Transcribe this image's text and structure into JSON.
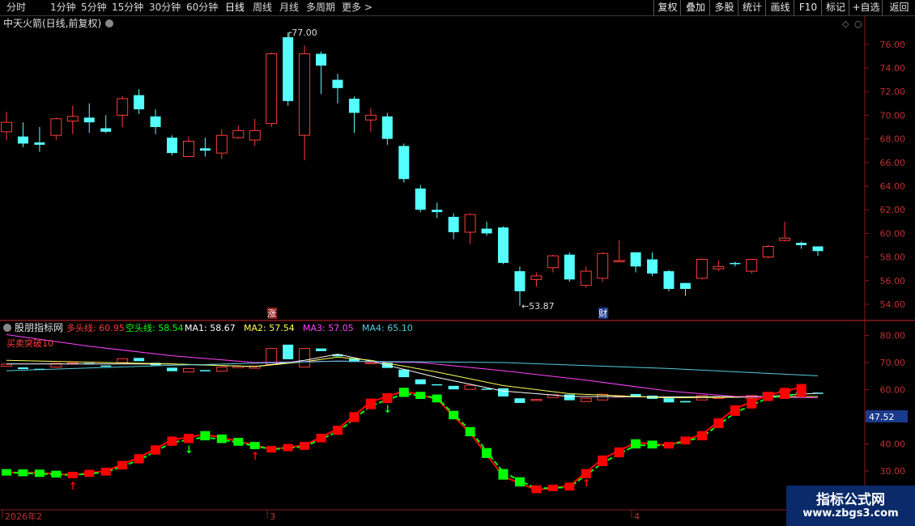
{
  "toolbar": {
    "periods": [
      "分时",
      "1分钟",
      "5分钟",
      "15分钟",
      "30分钟",
      "60分钟",
      "日线",
      "周线",
      "月线",
      "多周期",
      "更多 >"
    ],
    "active_period": "日线",
    "right_buttons": [
      "复权",
      "叠加",
      "多股",
      "统计",
      "画线",
      "F10",
      "标记",
      "+自选",
      "返回"
    ]
  },
  "main_panel": {
    "title": "中天火箭(日线,前复权)",
    "high_marker": "77.00",
    "low_marker": "53.87",
    "event_labels": [
      "涨",
      "财"
    ],
    "price_axis": [
      "76.00",
      "74.00",
      "72.00",
      "70.00",
      "68.00",
      "66.00",
      "64.00",
      "62.00",
      "60.00",
      "58.00",
      "56.00",
      "54.00"
    ]
  },
  "indicator_panel": {
    "name": "股朋指标网",
    "items": [
      {
        "label": "多头线:",
        "value": "60.95",
        "color": "#ff3b3b"
      },
      {
        "label": "空头线:",
        "value": "58.54",
        "color": "#00ff00"
      },
      {
        "label": "MA1:",
        "value": "58.67",
        "color": "#ffffff"
      },
      {
        "label": "MA2:",
        "value": "57.54",
        "color": "#ffff55"
      },
      {
        "label": "MA3:",
        "value": "57.05",
        "color": "#ff44ff"
      },
      {
        "label": "MA4:",
        "value": "65.10",
        "color": "#55ccdd"
      }
    ],
    "sub_label": "买卖突破10",
    "axis": [
      "80.00",
      "70.00",
      "60.00",
      "40.00",
      "30.00"
    ],
    "current_value": "47.52"
  },
  "date_axis": {
    "labels": [
      "2026年2",
      "3",
      "4"
    ]
  },
  "watermark": {
    "line1": "指标公式网",
    "line2": "www.zbgs3.com"
  },
  "colors": {
    "up": "#ff3b3b",
    "down": "#55ffff",
    "background": "#000000",
    "grid": "#8a1a1a",
    "bull": "#ff0000",
    "bear": "#00ff00"
  },
  "chart_data": {
    "type": "candlestick",
    "candles": [
      [
        68.6,
        69.4,
        70.3,
        67.9
      ],
      [
        68.2,
        67.6,
        69.4,
        67.3
      ],
      [
        67.7,
        67.5,
        69.0,
        66.9
      ],
      [
        68.3,
        69.7,
        69.8,
        67.9
      ],
      [
        69.5,
        69.9,
        70.8,
        68.4
      ],
      [
        69.8,
        69.4,
        71.0,
        68.5
      ],
      [
        68.9,
        68.6,
        70.0,
        68.5
      ],
      [
        70.0,
        71.4,
        71.6,
        69.0
      ],
      [
        71.7,
        70.5,
        72.2,
        70.1
      ],
      [
        69.9,
        69.0,
        70.5,
        68.4
      ],
      [
        68.1,
        66.8,
        68.3,
        66.6
      ],
      [
        66.5,
        67.8,
        68.2,
        66.5
      ],
      [
        67.2,
        67.0,
        68.1,
        66.5
      ],
      [
        66.8,
        68.3,
        68.8,
        66.3
      ],
      [
        68.1,
        68.7,
        69.1,
        68.0
      ],
      [
        67.9,
        68.7,
        69.7,
        67.4
      ],
      [
        69.3,
        75.2,
        75.3,
        69.0
      ],
      [
        76.6,
        71.2,
        77.0,
        70.8
      ],
      [
        68.3,
        75.2,
        75.9,
        66.2
      ],
      [
        75.2,
        74.2,
        75.4,
        71.8
      ],
      [
        73.0,
        72.3,
        73.5,
        71.0
      ],
      [
        71.4,
        70.2,
        71.6,
        68.5
      ],
      [
        69.6,
        70.0,
        70.6,
        68.6
      ],
      [
        69.9,
        68.0,
        70.2,
        67.5
      ],
      [
        67.4,
        64.6,
        67.6,
        64.3
      ],
      [
        63.8,
        62.0,
        64.1,
        61.8
      ],
      [
        62.0,
        61.8,
        62.6,
        61.3
      ],
      [
        61.4,
        60.1,
        61.7,
        59.5
      ],
      [
        60.1,
        61.6,
        61.7,
        59.1
      ],
      [
        60.4,
        60.0,
        61.0,
        59.8
      ],
      [
        60.5,
        57.5,
        60.6,
        57.4
      ],
      [
        56.8,
        55.1,
        57.2,
        53.87
      ],
      [
        56.1,
        56.4,
        56.7,
        55.5
      ],
      [
        57.1,
        58.1,
        58.2,
        56.7
      ],
      [
        58.2,
        56.1,
        58.4,
        55.9
      ],
      [
        55.6,
        56.8,
        57.2,
        55.4
      ],
      [
        56.2,
        58.3,
        58.4,
        55.9
      ],
      [
        57.7,
        57.7,
        59.4,
        57.7
      ],
      [
        58.4,
        57.2,
        58.4,
        56.7
      ],
      [
        57.8,
        56.6,
        58.4,
        56.4
      ],
      [
        56.8,
        55.3,
        56.9,
        55.1
      ],
      [
        55.8,
        55.3,
        55.8,
        54.7
      ],
      [
        56.2,
        57.8,
        57.9,
        56.1
      ],
      [
        57.0,
        57.2,
        57.7,
        56.8
      ],
      [
        57.5,
        57.4,
        57.6,
        57.2
      ],
      [
        56.8,
        57.8,
        57.8,
        56.6
      ],
      [
        58.0,
        58.9,
        59.0,
        57.9
      ],
      [
        59.4,
        59.6,
        61.0,
        59.3
      ],
      [
        59.2,
        59.0,
        59.3,
        58.7
      ],
      [
        58.9,
        58.5,
        58.9,
        58.1
      ]
    ],
    "price_range": [
      53.0,
      77.8
    ],
    "bull_line": [
      [
        0,
        29.5
      ],
      [
        2,
        29.3
      ],
      [
        4,
        28.5
      ],
      [
        6,
        30.0
      ],
      [
        8,
        35.0
      ],
      [
        10,
        41.5
      ],
      [
        12,
        43.5
      ],
      [
        14,
        41.0
      ],
      [
        16,
        38.0
      ],
      [
        18,
        39.5
      ],
      [
        20,
        45.5
      ],
      [
        22,
        55.5
      ],
      [
        24,
        59.5
      ],
      [
        26,
        56.5
      ],
      [
        28,
        44.0
      ],
      [
        30,
        28.0
      ],
      [
        32,
        23.0
      ],
      [
        34,
        24.5
      ],
      [
        36,
        34.5
      ],
      [
        38,
        40.5
      ],
      [
        40,
        39.5
      ],
      [
        42,
        43.5
      ],
      [
        44,
        53.0
      ],
      [
        46,
        58.0
      ],
      [
        48,
        60.9
      ]
    ],
    "bear_line": [
      [
        0,
        29.5
      ],
      [
        2,
        29.0
      ],
      [
        4,
        28.5
      ],
      [
        6,
        29.5
      ],
      [
        8,
        34.0
      ],
      [
        10,
        40.5
      ],
      [
        12,
        42.5
      ],
      [
        14,
        40.5
      ],
      [
        16,
        38.0
      ],
      [
        18,
        39.0
      ],
      [
        20,
        44.5
      ],
      [
        22,
        54.0
      ],
      [
        24,
        58.5
      ],
      [
        26,
        57.0
      ],
      [
        28,
        45.0
      ],
      [
        30,
        29.5
      ],
      [
        32,
        23.5
      ],
      [
        34,
        24.0
      ],
      [
        36,
        33.0
      ],
      [
        38,
        39.5
      ],
      [
        40,
        39.5
      ],
      [
        42,
        42.5
      ],
      [
        44,
        51.5
      ],
      [
        46,
        57.0
      ],
      [
        48,
        58.54
      ]
    ],
    "buy_arrows": [
      4,
      15,
      35
    ],
    "sell_arrows": [
      11,
      23
    ],
    "ma_lines": [
      {
        "name": "MA1",
        "color": "#ffffff",
        "points": [
          [
            0,
            69.5
          ],
          [
            10,
            69.5
          ],
          [
            15,
            68.5
          ],
          [
            18,
            70.8
          ],
          [
            20,
            73.1
          ],
          [
            22,
            70.5
          ],
          [
            26,
            64.5
          ],
          [
            30,
            59.5
          ],
          [
            34,
            57.5
          ],
          [
            40,
            57.3
          ],
          [
            46,
            57.5
          ],
          [
            49,
            58.7
          ]
        ]
      },
      {
        "name": "MA2",
        "color": "#ffff55",
        "points": [
          [
            0,
            70.8
          ],
          [
            10,
            69.5
          ],
          [
            15,
            68.5
          ],
          [
            18,
            70.3
          ],
          [
            20,
            72.0
          ],
          [
            22,
            70.8
          ],
          [
            26,
            66.5
          ],
          [
            30,
            61.5
          ],
          [
            34,
            58.5
          ],
          [
            40,
            57.0
          ],
          [
            46,
            57.3
          ],
          [
            49,
            57.5
          ]
        ]
      },
      {
        "name": "MA3",
        "color": "#ff44ff",
        "points": [
          [
            0,
            80.3
          ],
          [
            5,
            76.0
          ],
          [
            10,
            72.5
          ],
          [
            15,
            70.0
          ],
          [
            20,
            70.5
          ],
          [
            25,
            70.0
          ],
          [
            30,
            67.0
          ],
          [
            35,
            63.5
          ],
          [
            40,
            59.5
          ],
          [
            44,
            57.5
          ],
          [
            49,
            57.0
          ]
        ]
      },
      {
        "name": "MA4",
        "color": "#55ccdd",
        "points": [
          [
            0,
            67.0
          ],
          [
            10,
            69.0
          ],
          [
            20,
            70.5
          ],
          [
            30,
            70.0
          ],
          [
            40,
            67.8
          ],
          [
            49,
            65.1
          ]
        ]
      }
    ],
    "indicator_range": [
      22,
      83
    ]
  }
}
